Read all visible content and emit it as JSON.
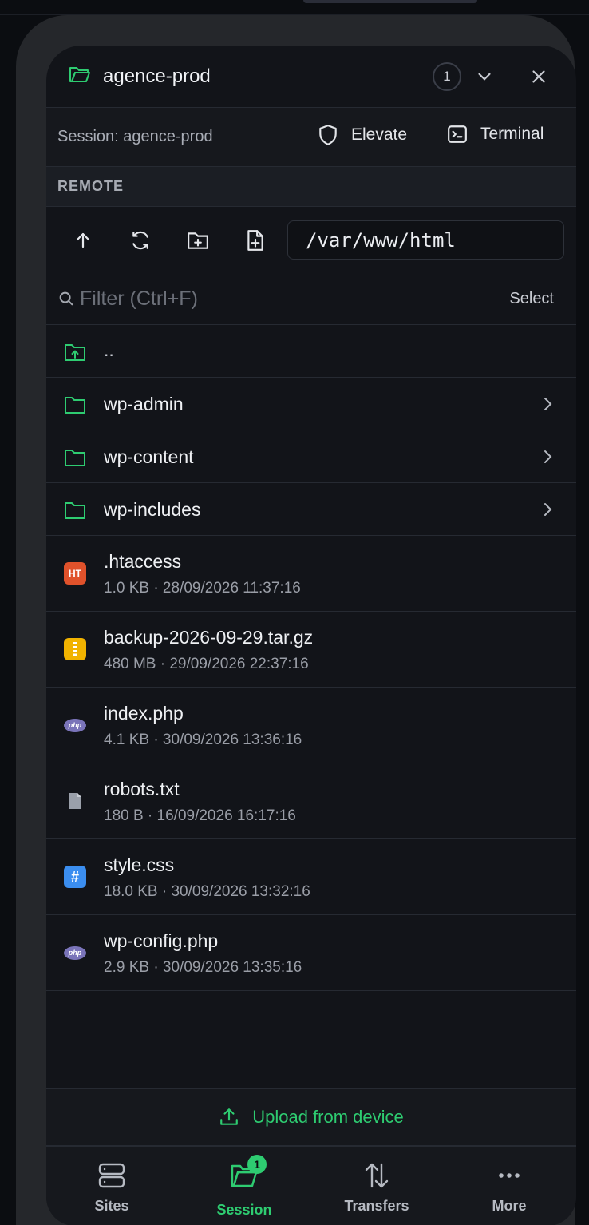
{
  "header": {
    "title": "agence-prod",
    "session_count": "1"
  },
  "session": {
    "label": "Session: agence-prod",
    "elevate_label": "Elevate",
    "terminal_label": "Terminal"
  },
  "remote": {
    "section_label": "REMOTE",
    "path": "/var/www/html"
  },
  "filter": {
    "placeholder": "Filter (Ctrl+F)",
    "select_label": "Select"
  },
  "parent_dir": {
    "name": ".."
  },
  "folders": [
    {
      "name": "wp-admin"
    },
    {
      "name": "wp-content"
    },
    {
      "name": "wp-includes"
    }
  ],
  "files": [
    {
      "name": ".htaccess",
      "meta": "1.0 KB · 28/09/2026 11:37:16",
      "icon": "htaccess-icon",
      "badge": "HT"
    },
    {
      "name": "backup-2026-09-29.tar.gz",
      "meta": "480 MB · 29/09/2026 22:37:16",
      "icon": "archive-icon",
      "badge": ""
    },
    {
      "name": "index.php",
      "meta": "4.1 KB · 30/09/2026 13:36:16",
      "icon": "php-icon",
      "badge": "php"
    },
    {
      "name": "robots.txt",
      "meta": "180 B · 16/09/2026 16:17:16",
      "icon": "text-file-icon",
      "badge": ""
    },
    {
      "name": "style.css",
      "meta": "18.0 KB · 30/09/2026 13:32:16",
      "icon": "css-icon",
      "badge": "#"
    },
    {
      "name": "wp-config.php",
      "meta": "2.9 KB · 30/09/2026 13:35:16",
      "icon": "php-icon",
      "badge": "php"
    }
  ],
  "upload": {
    "label": "Upload from device"
  },
  "nav": {
    "sites": "Sites",
    "session": "Session",
    "session_badge": "1",
    "transfers": "Transfers",
    "more": "More"
  },
  "colors": {
    "accent": "#2ecc71",
    "background": "#121419",
    "htaccess": "#e0522b",
    "archive": "#f1b300",
    "css": "#3b8ef0",
    "php": "#7a74b9"
  }
}
